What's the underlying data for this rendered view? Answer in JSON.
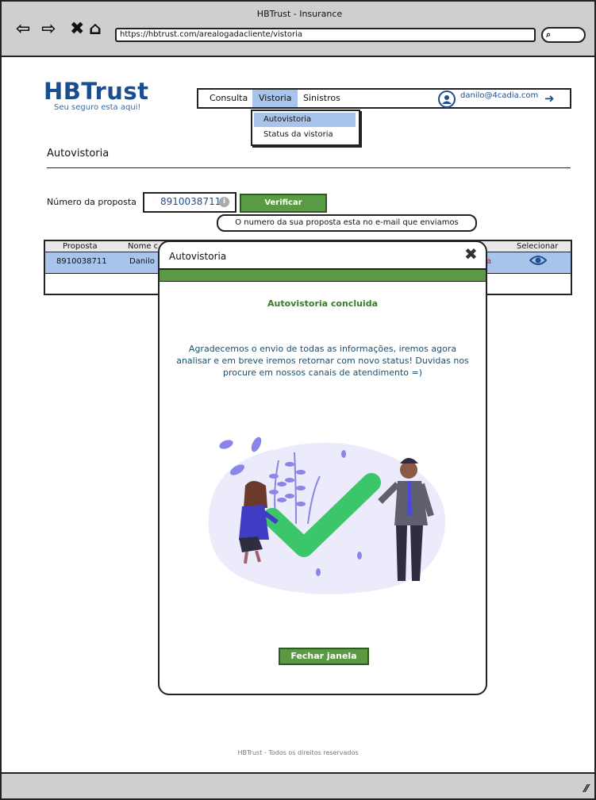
{
  "window": {
    "title": "HBTrust - Insurance",
    "url": "https://hbtrust.com/arealogadacliente/vistoria"
  },
  "brand": {
    "logo": "HBTrust",
    "slogan": "Seu seguro esta aqui!",
    "color": "#1a4e8f"
  },
  "nav": {
    "items": [
      {
        "label": "Consulta"
      },
      {
        "label": "Vistoria",
        "active": true
      },
      {
        "label": "Sinistros"
      }
    ],
    "user_email": "danilo@4cadia.com",
    "icons": [
      "user-icon",
      "logout-icon"
    ]
  },
  "dropdown": {
    "items": [
      {
        "label": "Autovistoria",
        "highlighted": true
      },
      {
        "label": "Status da vistoria"
      }
    ]
  },
  "page": {
    "section_title": "Autovistoria",
    "proposal_label": "Número da proposta",
    "proposal_value": "8910038711",
    "verify_label": "Verificar",
    "tooltip": "O numero da sua proposta esta no e-mail que enviamos"
  },
  "table": {
    "headers": [
      "Proposta",
      "Nome c",
      "Selecionar"
    ],
    "rows": [
      {
        "proposta": "8910038711",
        "nome": "Danilo",
        "trailing": "a"
      }
    ]
  },
  "modal": {
    "title": "Autovistoria",
    "heading": "Autovistoria concluida",
    "message": "Agradecemos o envio de todas as informações, iremos agora analisar e em breve iremos retornar com novo status! Duvidas nos procure em nossos canais de atendimento =)",
    "close_label": "Fechar janela"
  },
  "footer": "HBTrust - Todos os direitos reservados",
  "colors": {
    "accent_green": "#5a9a42",
    "highlight_blue": "#a9c4eb",
    "check_green": "#3cc66a"
  }
}
